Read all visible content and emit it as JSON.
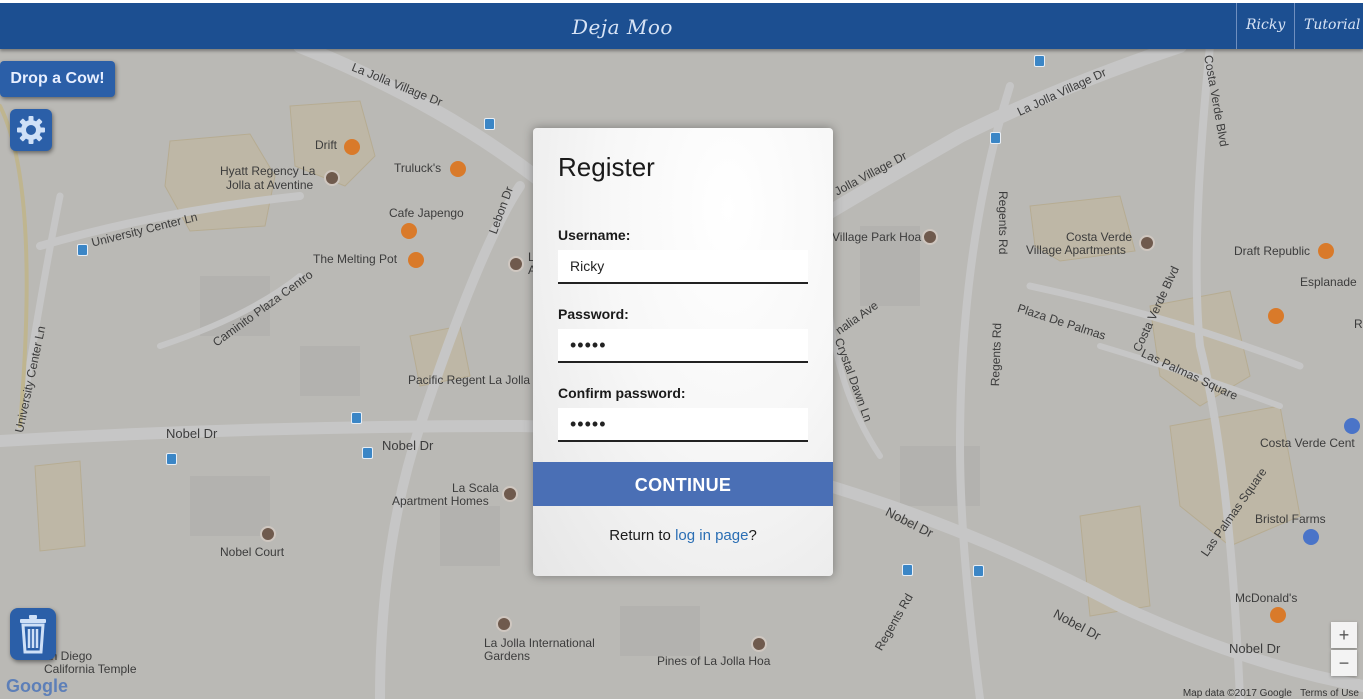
{
  "header": {
    "brand": "Deja Moo",
    "user_link": "Ricky",
    "tutorial_link": "Tutorial"
  },
  "controls": {
    "drop_cow_label": "Drop a Cow!"
  },
  "register": {
    "title": "Register",
    "username_label": "Username:",
    "username_value": "Ricky",
    "password_label": "Password:",
    "password_value": "•••••",
    "confirm_label": "Confirm password:",
    "confirm_value": "•••••",
    "continue_label": "CONTINUE",
    "return_prefix": "Return to ",
    "return_link": "log in page",
    "return_suffix": "?"
  },
  "map": {
    "streets": [
      "La Jolla Village Dr",
      "La Jolla Village Dr",
      "Jolla Village Dr",
      "University Center Ln",
      "University Center Ln",
      "Caminito Plaza Centro",
      "Lebon Dr",
      "Nobel Dr",
      "Nobel Dr",
      "Nobel Dr",
      "Nobel Dr",
      "Nobel Dr",
      "Regents Rd",
      "Regents Rd",
      "Regents Rd",
      "Costa Verde Blvd",
      "Costa Verde Blvd",
      "Plaza De Palmas",
      "Las Palmas Square",
      "Las Palmas Square",
      "Crystal Dawn Ln",
      "Esplanade",
      "nalia Ave"
    ],
    "places": [
      "Drift",
      "Hyatt Regency La",
      "Jolla at Aventine",
      "Truluck's",
      "Cafe Japengo",
      "The Melting Pot",
      "Pacific Regent La Jolla",
      "La Scala",
      "Apartment Homes",
      "Nobel Court",
      "La Jolla International",
      "Gardens",
      "Pines of La Jolla Hoa",
      "an Diego",
      "California Temple",
      "Village Park Hoa",
      "Costa Verde",
      "Village Apartments",
      "Draft Republic",
      "Costa Verde Cent",
      "Bristol Farms",
      "McDonald's",
      "L",
      "A",
      "R"
    ],
    "attribution": "Map data ©2017 Google",
    "terms": "Terms of Use",
    "google_logo": "Google",
    "zoom_in": "+",
    "zoom_out": "−"
  },
  "colors": {
    "header_bg": "#1c4f91",
    "button_bg": "#2b5fa8",
    "continue_bg": "#4a6fb5",
    "link": "#2a6eb4"
  }
}
